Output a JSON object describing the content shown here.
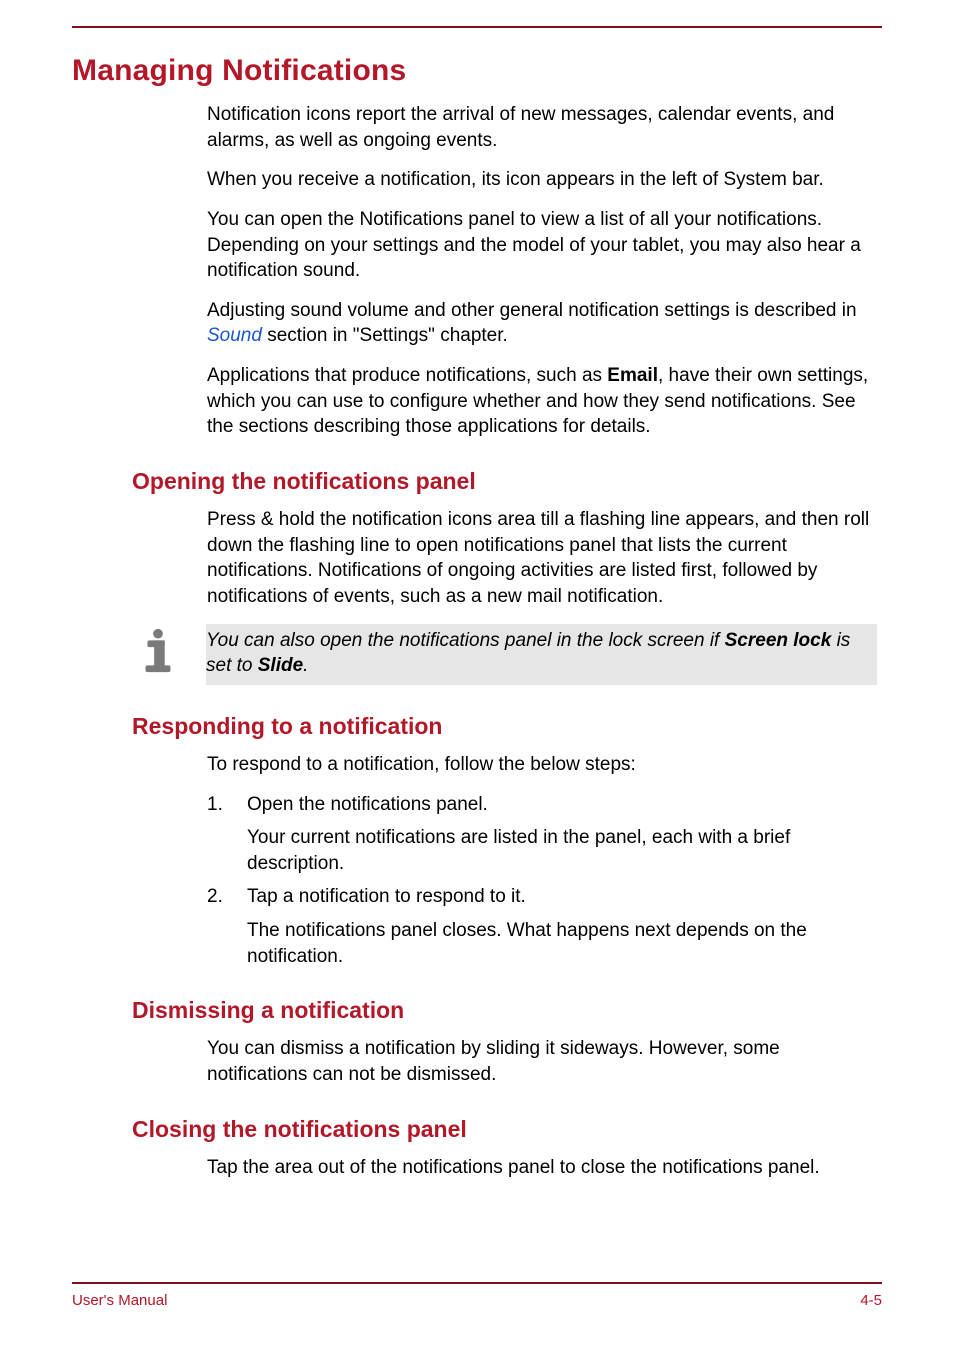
{
  "h1": "Managing Notifications",
  "intro": {
    "p1": "Notification icons report the arrival of new messages, calendar events, and alarms, as well as ongoing events.",
    "p2": "When you receive a notification, its icon appears in the left of System bar.",
    "p3": "You can open the Notifications panel to view a list of all your notifications. Depending on your settings and the model of your tablet, you may also hear a notification sound.",
    "p4a": "Adjusting sound volume and other general notification settings is described in ",
    "p4_link": "Sound",
    "p4b": " section in \"Settings\" chapter.",
    "p5a": "Applications that produce notifications, such as ",
    "p5_bold": "Email",
    "p5b": ", have their own settings, which you can use to configure whether and how they send notifications. See the sections describing those applications for details."
  },
  "sec1": {
    "h2": "Opening the notifications panel",
    "p1": "Press & hold the notification icons area till a flashing line appears, and then roll down the flashing line to open notifications panel that lists the current notifications. Notifications of ongoing activities are listed first, followed by notifications of events, such as a new mail notification.",
    "note_a": "You can also open the notifications panel in the lock screen if ",
    "note_b1": "Screen lock",
    "note_c": " is set to ",
    "note_b2": "Slide",
    "note_d": "."
  },
  "sec2": {
    "h2": "Responding to a notification",
    "p1": "To respond to a notification, follow the below steps:",
    "steps": [
      {
        "num": "1.",
        "title": "Open the notifications panel.",
        "desc": "Your current notifications are listed in the panel, each with a brief description."
      },
      {
        "num": "2.",
        "title": "Tap a notification to respond to it.",
        "desc": "The notifications panel closes. What happens next depends on the notification."
      }
    ]
  },
  "sec3": {
    "h2": "Dismissing a notification",
    "p1": "You can dismiss a notification by sliding it sideways. However, some notifications can not be dismissed."
  },
  "sec4": {
    "h2": "Closing the notifications panel",
    "p1": "Tap the area out of the notifications panel to close the notifications panel."
  },
  "footer": {
    "left": "User's Manual",
    "right": "4-5"
  }
}
